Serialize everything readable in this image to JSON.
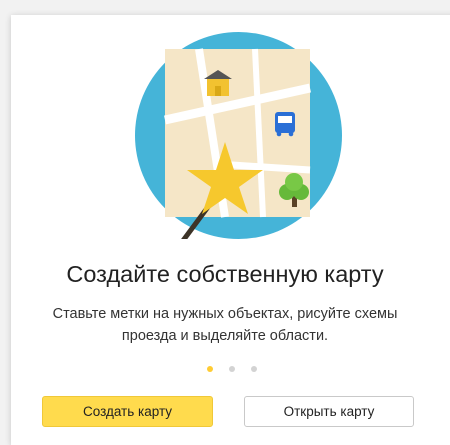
{
  "promo": {
    "title": "Создайте собственную карту",
    "description_line1": "Ставьте метки на нужных объектах, рисуйте схемы",
    "description_line2": "проезда и выделяйте области."
  },
  "carousel": {
    "dots_count": 3,
    "active_index": 0
  },
  "buttons": {
    "create_label": "Создать карту",
    "open_label": "Открыть карту"
  },
  "colors": {
    "circle": "#45b4d8",
    "map": "#f5e6c7",
    "road": "#ffffff",
    "primary_button": "#ffdb4d",
    "active_dot": "#ffcc33",
    "inactive_dot": "#d3d3d3"
  },
  "illustration": {
    "icons": [
      "house-icon",
      "bus-icon",
      "tree-icon",
      "star-icon",
      "magic-wand-icon"
    ]
  }
}
